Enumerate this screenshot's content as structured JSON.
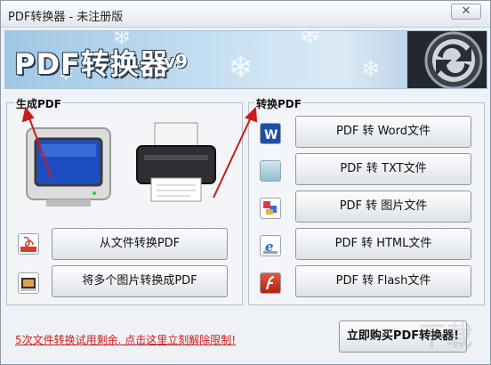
{
  "window": {
    "title": "PDF转换器 - 未注册版",
    "close_label": "✕"
  },
  "banner": {
    "logo_text": "PDF转换器",
    "version": "v9"
  },
  "left_group": {
    "label": "生成PDF",
    "buttons": [
      {
        "label": "从文件转换PDF",
        "icon": "pdf-file-icon"
      },
      {
        "label": "将多个图片转换成PDF",
        "icon": "image-file-icon"
      }
    ]
  },
  "right_group": {
    "label": "转换PDF",
    "buttons": [
      {
        "label": "PDF 转 Word文件",
        "icon": "word-icon"
      },
      {
        "label": "PDF 转 TXT文件",
        "icon": "txt-icon"
      },
      {
        "label": "PDF 转 图片文件",
        "icon": "image-icon"
      },
      {
        "label": "PDF 转 HTML文件",
        "icon": "html-icon"
      },
      {
        "label": "PDF 转 Flash文件",
        "icon": "flash-icon"
      }
    ]
  },
  "footer": {
    "trial_text": "5次文件转换试用剩余. 点击这里立刻解除限制!",
    "buy_label": "立即购买PDF转换器!"
  },
  "colors": {
    "accent_red": "#d11c1c",
    "banner_blue": "#9fc7e6"
  }
}
